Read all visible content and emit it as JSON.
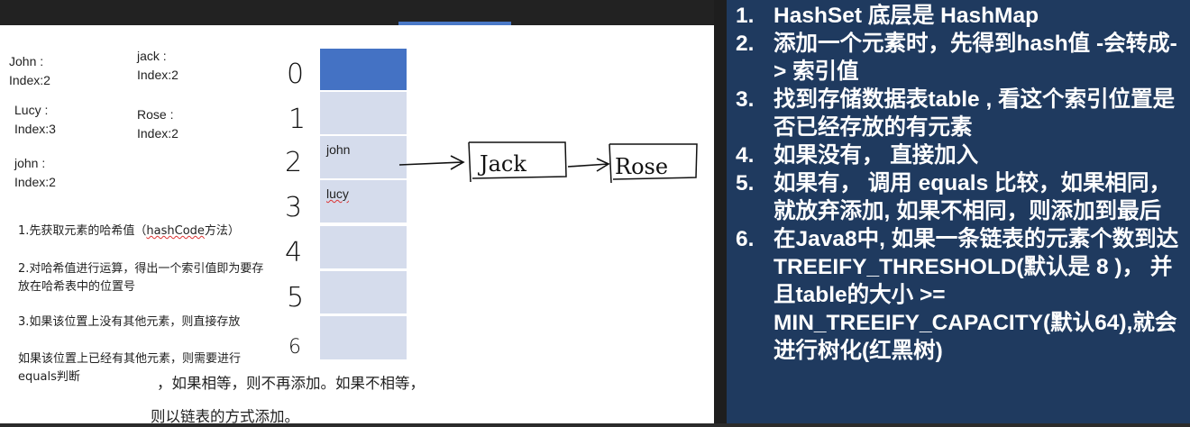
{
  "left_notes": [
    {
      "name": "John",
      "index": "Index:2"
    },
    {
      "name": "jack",
      "index": "Index:2"
    },
    {
      "name": "Lucy",
      "index": "Index:3"
    },
    {
      "name": "Rose",
      "index": "Index:2"
    },
    {
      "name": "john",
      "index": "Index:2"
    }
  ],
  "table": {
    "row_numbers": [
      "0",
      "1",
      "2",
      "3",
      "4",
      "5",
      "6"
    ],
    "cells": [
      "",
      "",
      "john",
      "lucy",
      "",
      "",
      ""
    ],
    "chain": [
      "Jack",
      "Rose"
    ]
  },
  "steps": {
    "p1_a": "1.先获取元素的哈希值（",
    "p1_b": "hashCode",
    "p1_c": "方法）",
    "p2": "2.对哈希值进行运算，得出一个索引值即为要存放在哈希表中的位置号",
    "p3a": "3.如果该位置上没有其他元素，则直接存放",
    "p3b": "如果该位置上已经有其他元素，则需要进行equals判断",
    "p3c": "，如果相等，则不再添加。如果不相等，",
    "p3d": "则以链表的方式添加。"
  },
  "right_list": [
    {
      "num": "1.",
      "text": "HashSet 底层是 HashMap"
    },
    {
      "num": "2.",
      "text": "添加一个元素时，先得到hash值 -会转成-> 索引值"
    },
    {
      "num": "3.",
      "text": "找到存储数据表table , 看这个索引位置是否已经存放的有元素"
    },
    {
      "num": "4.",
      "text": "如果没有， 直接加入"
    },
    {
      "num": "5.",
      "text": "如果有， 调用 equals 比较，如果相同，就放弃添加, 如果不相同，则添加到最后"
    },
    {
      "num": "6.",
      "text": "在Java8中, 如果一条链表的元素个数到达 TREEIFY_THRESHOLD(默认是 8 )， 并且table的大小 >= MIN_TREEIFY_CAPACITY(默认64),就会进行树化(红黑树)"
    }
  ]
}
